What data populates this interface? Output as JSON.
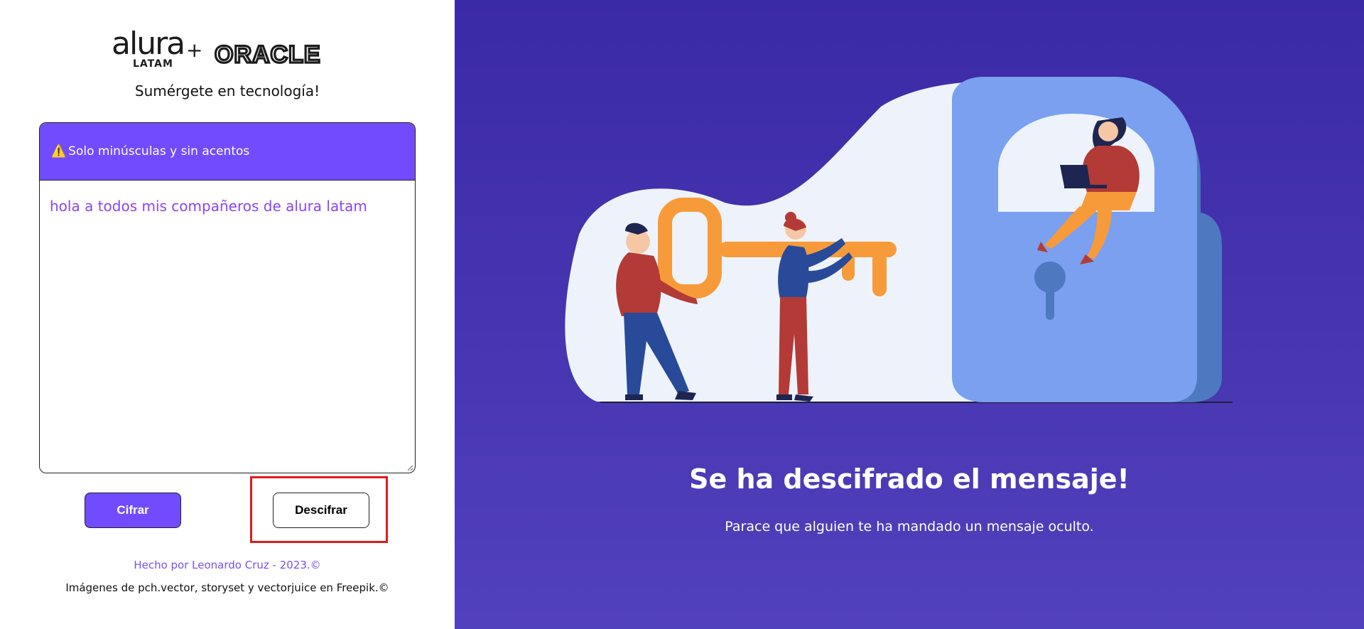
{
  "header": {
    "logo_alura": "alura",
    "logo_latam": "LATAM",
    "logo_plus": "+",
    "logo_oracle": "ORACLE",
    "tagline": "Sumérgete en tecnología!"
  },
  "input_card": {
    "warning_icon": "⚠️",
    "warning_text": "Solo minúsculas y sin acentos",
    "text_value": "hola a todos mis compañeros de alura latam"
  },
  "buttons": {
    "encrypt_label": "Cifrar",
    "decrypt_label": "Descifrar"
  },
  "footer": {
    "credit": "Hecho por Leonardo Cruz - 2023.©",
    "images_credit": "Imágenes de pch.vector, storyset y vectorjuice en Freepik.©"
  },
  "result": {
    "title": "Se ha descifrado el mensaje!",
    "subtitle": "Parace que alguien te ha mandado un mensaje oculto."
  },
  "colors": {
    "accent": "#714cfe",
    "panel_bg": "#4634b0",
    "highlight": "#e01b1b",
    "text_value": "#8a44f0"
  }
}
